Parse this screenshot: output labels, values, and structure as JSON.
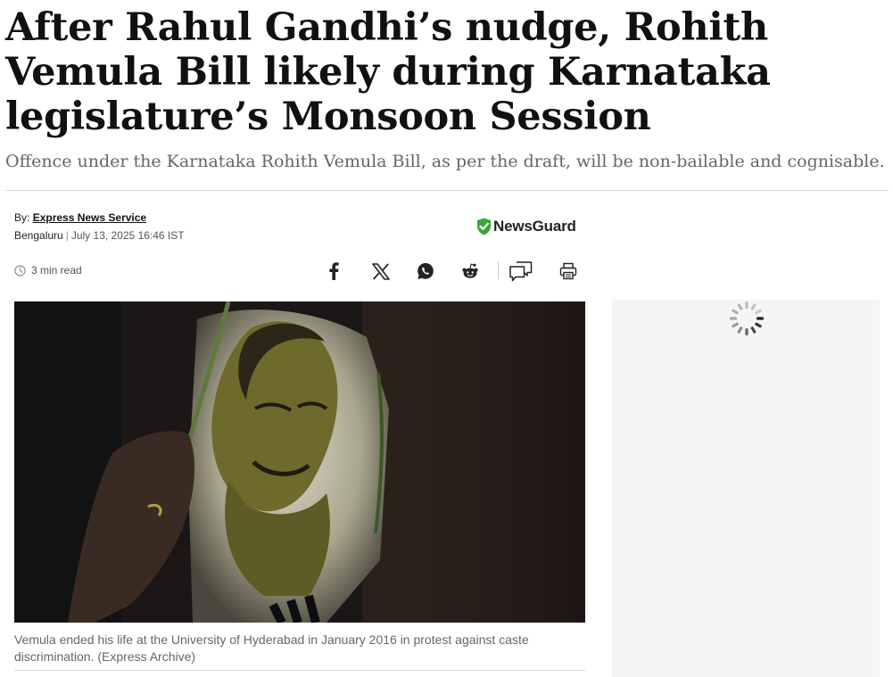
{
  "article": {
    "headline": "After Rahul Gandhi’s nudge, Rohith Vemula Bill likely during Karnataka legislature’s Monsoon Session",
    "subheadline": "Offence under the Karnataka Rohith Vemula Bill, as per the draft, will be non-bailable and cognisable.",
    "byline_prefix": "By:",
    "author": "Express News Service",
    "location": "Bengaluru",
    "separator": "|",
    "date": "July 13, 2025 16:46 IST",
    "read_time": "3 min read"
  },
  "badge": {
    "name": "NewsGuard",
    "color": "#3aa53a"
  },
  "share": {
    "icons": [
      "facebook-icon",
      "x-icon",
      "whatsapp-icon",
      "reddit-icon",
      "comments-icon",
      "print-icon"
    ]
  },
  "image": {
    "caption": "Vemula ended his life at the University of Hyderabad in January 2016 in protest against caste discrimination. (Express Archive)"
  },
  "sidebar": {
    "ad_state": "loading-spinner-icon"
  }
}
